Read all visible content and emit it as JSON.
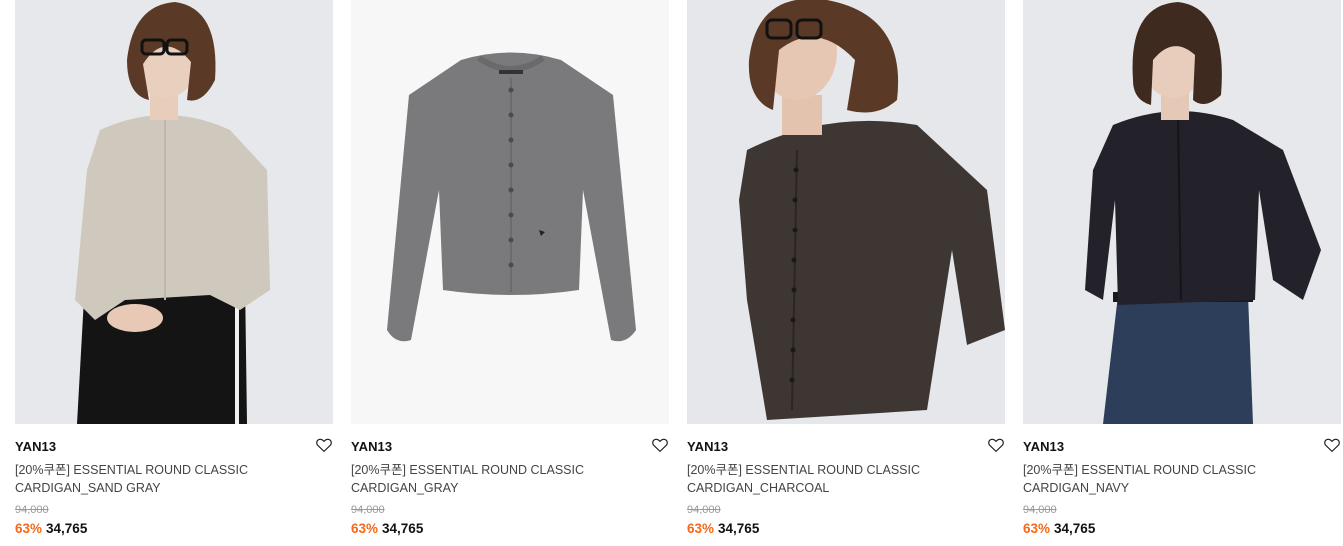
{
  "products": [
    {
      "brand": "YAN13",
      "title_line1": "[20%쿠폰] ESSENTIAL ROUND CLASSIC",
      "title_line2": "CARDIGAN_SAND GRAY",
      "original_price": "94,000",
      "discount": "63%",
      "price": "34,765",
      "image_alt": "Model wearing sand gray cardigan",
      "garment_color": "#cfc8bd"
    },
    {
      "brand": "YAN13",
      "title_line1": "[20%쿠폰] ESSENTIAL ROUND CLASSIC",
      "title_line2": "CARDIGAN_GRAY",
      "original_price": "94,000",
      "discount": "63%",
      "price": "34,765",
      "image_alt": "Gray cardigan flat lay",
      "garment_color": "#7a7a7c"
    },
    {
      "brand": "YAN13",
      "title_line1": "[20%쿠폰] ESSENTIAL ROUND CLASSIC",
      "title_line2": "CARDIGAN_CHARCOAL",
      "original_price": "94,000",
      "discount": "63%",
      "price": "34,765",
      "image_alt": "Model wearing charcoal cardigan",
      "garment_color": "#3e3632"
    },
    {
      "brand": "YAN13",
      "title_line1": "[20%쿠폰] ESSENTIAL ROUND CLASSIC",
      "title_line2": "CARDIGAN_NAVY",
      "original_price": "94,000",
      "discount": "63%",
      "price": "34,765",
      "image_alt": "Model wearing navy cardigan",
      "garment_color": "#23222a"
    }
  ],
  "colors": {
    "discount": "#f36a1c",
    "original_price": "#9a9a9a",
    "title": "#444444"
  },
  "icons": {
    "wishlist": "heart-outline-icon"
  }
}
